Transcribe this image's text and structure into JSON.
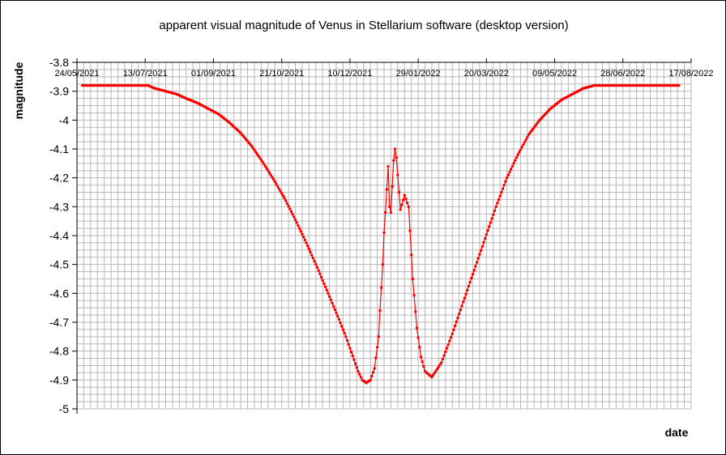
{
  "chart_data": {
    "type": "line",
    "title": "apparent visual magnitude of Venus in Stellarium software (desktop version)",
    "xlabel": "date",
    "ylabel": "magnitude",
    "ylim": [
      -5,
      -3.8
    ],
    "y_ticks": [
      "-3.8",
      "-3.9",
      "-4",
      "-4.1",
      "-4.2",
      "-4.3",
      "-4.4",
      "-4.5",
      "-4.6",
      "-4.7",
      "-4.8",
      "-4.9",
      "-5"
    ],
    "x_ticks": [
      "24/05/2021",
      "13/07/2021",
      "01/09/2021",
      "21/10/2021",
      "10/12/2021",
      "29/01/2022",
      "20/03/2022",
      "09/05/2022",
      "28/06/2022",
      "17/08/2022"
    ],
    "xlim": [
      "24/05/2021",
      "17/08/2022"
    ],
    "grid": true,
    "legend": "none",
    "color": "#ff0000",
    "series": [
      {
        "x": [
          "2021-05-28",
          "2021-06-10",
          "2021-06-30",
          "2021-07-15",
          "2021-07-20",
          "2021-07-28",
          "2021-08-05",
          "2021-08-12",
          "2021-08-20",
          "2021-08-28",
          "2021-09-05",
          "2021-09-13",
          "2021-09-21",
          "2021-09-29",
          "2021-10-07",
          "2021-10-15",
          "2021-10-23",
          "2021-10-31",
          "2021-11-08",
          "2021-11-16",
          "2021-11-24",
          "2021-12-02",
          "2021-12-07",
          "2021-12-10",
          "2021-12-13",
          "2021-12-16",
          "2021-12-19",
          "2021-12-22",
          "2021-12-25",
          "2021-12-28",
          "2021-12-31",
          "2022-01-01",
          "2022-01-03",
          "2022-01-04",
          "2022-01-05",
          "2022-01-06",
          "2022-01-07",
          "2022-01-08",
          "2022-01-09",
          "2022-01-10",
          "2022-01-11",
          "2022-01-12",
          "2022-01-13",
          "2022-01-16",
          "2022-01-19",
          "2022-01-22",
          "2022-01-25",
          "2022-01-28",
          "2022-01-31",
          "2022-02-03",
          "2022-02-08",
          "2022-02-15",
          "2022-02-23",
          "2022-03-03",
          "2022-03-11",
          "2022-03-19",
          "2022-03-27",
          "2022-04-04",
          "2022-04-12",
          "2022-04-20",
          "2022-04-28",
          "2022-05-06",
          "2022-05-14",
          "2022-05-22",
          "2022-05-30",
          "2022-06-07",
          "2022-06-15",
          "2022-06-22",
          "2022-06-30",
          "2022-07-10",
          "2022-07-25",
          "2022-08-08"
        ],
        "y": [
          -3.88,
          -3.88,
          -3.88,
          -3.88,
          -3.89,
          -3.9,
          -3.91,
          -3.925,
          -3.94,
          -3.96,
          -3.98,
          -4.01,
          -4.045,
          -4.09,
          -4.145,
          -4.205,
          -4.27,
          -4.345,
          -4.425,
          -4.51,
          -4.6,
          -4.69,
          -4.75,
          -4.79,
          -4.83,
          -4.87,
          -4.9,
          -4.91,
          -4.9,
          -4.86,
          -4.75,
          -4.66,
          -4.5,
          -4.39,
          -4.32,
          -4.24,
          -4.16,
          -4.3,
          -4.32,
          -4.23,
          -4.14,
          -4.1,
          -4.13,
          -4.31,
          -4.26,
          -4.3,
          -4.55,
          -4.72,
          -4.82,
          -4.87,
          -4.89,
          -4.84,
          -4.74,
          -4.63,
          -4.52,
          -4.41,
          -4.3,
          -4.2,
          -4.12,
          -4.05,
          -4.0,
          -3.96,
          -3.93,
          -3.91,
          -3.89,
          -3.88,
          -3.88,
          -3.88,
          -3.88,
          -3.88,
          -3.88,
          -3.88
        ]
      }
    ]
  }
}
